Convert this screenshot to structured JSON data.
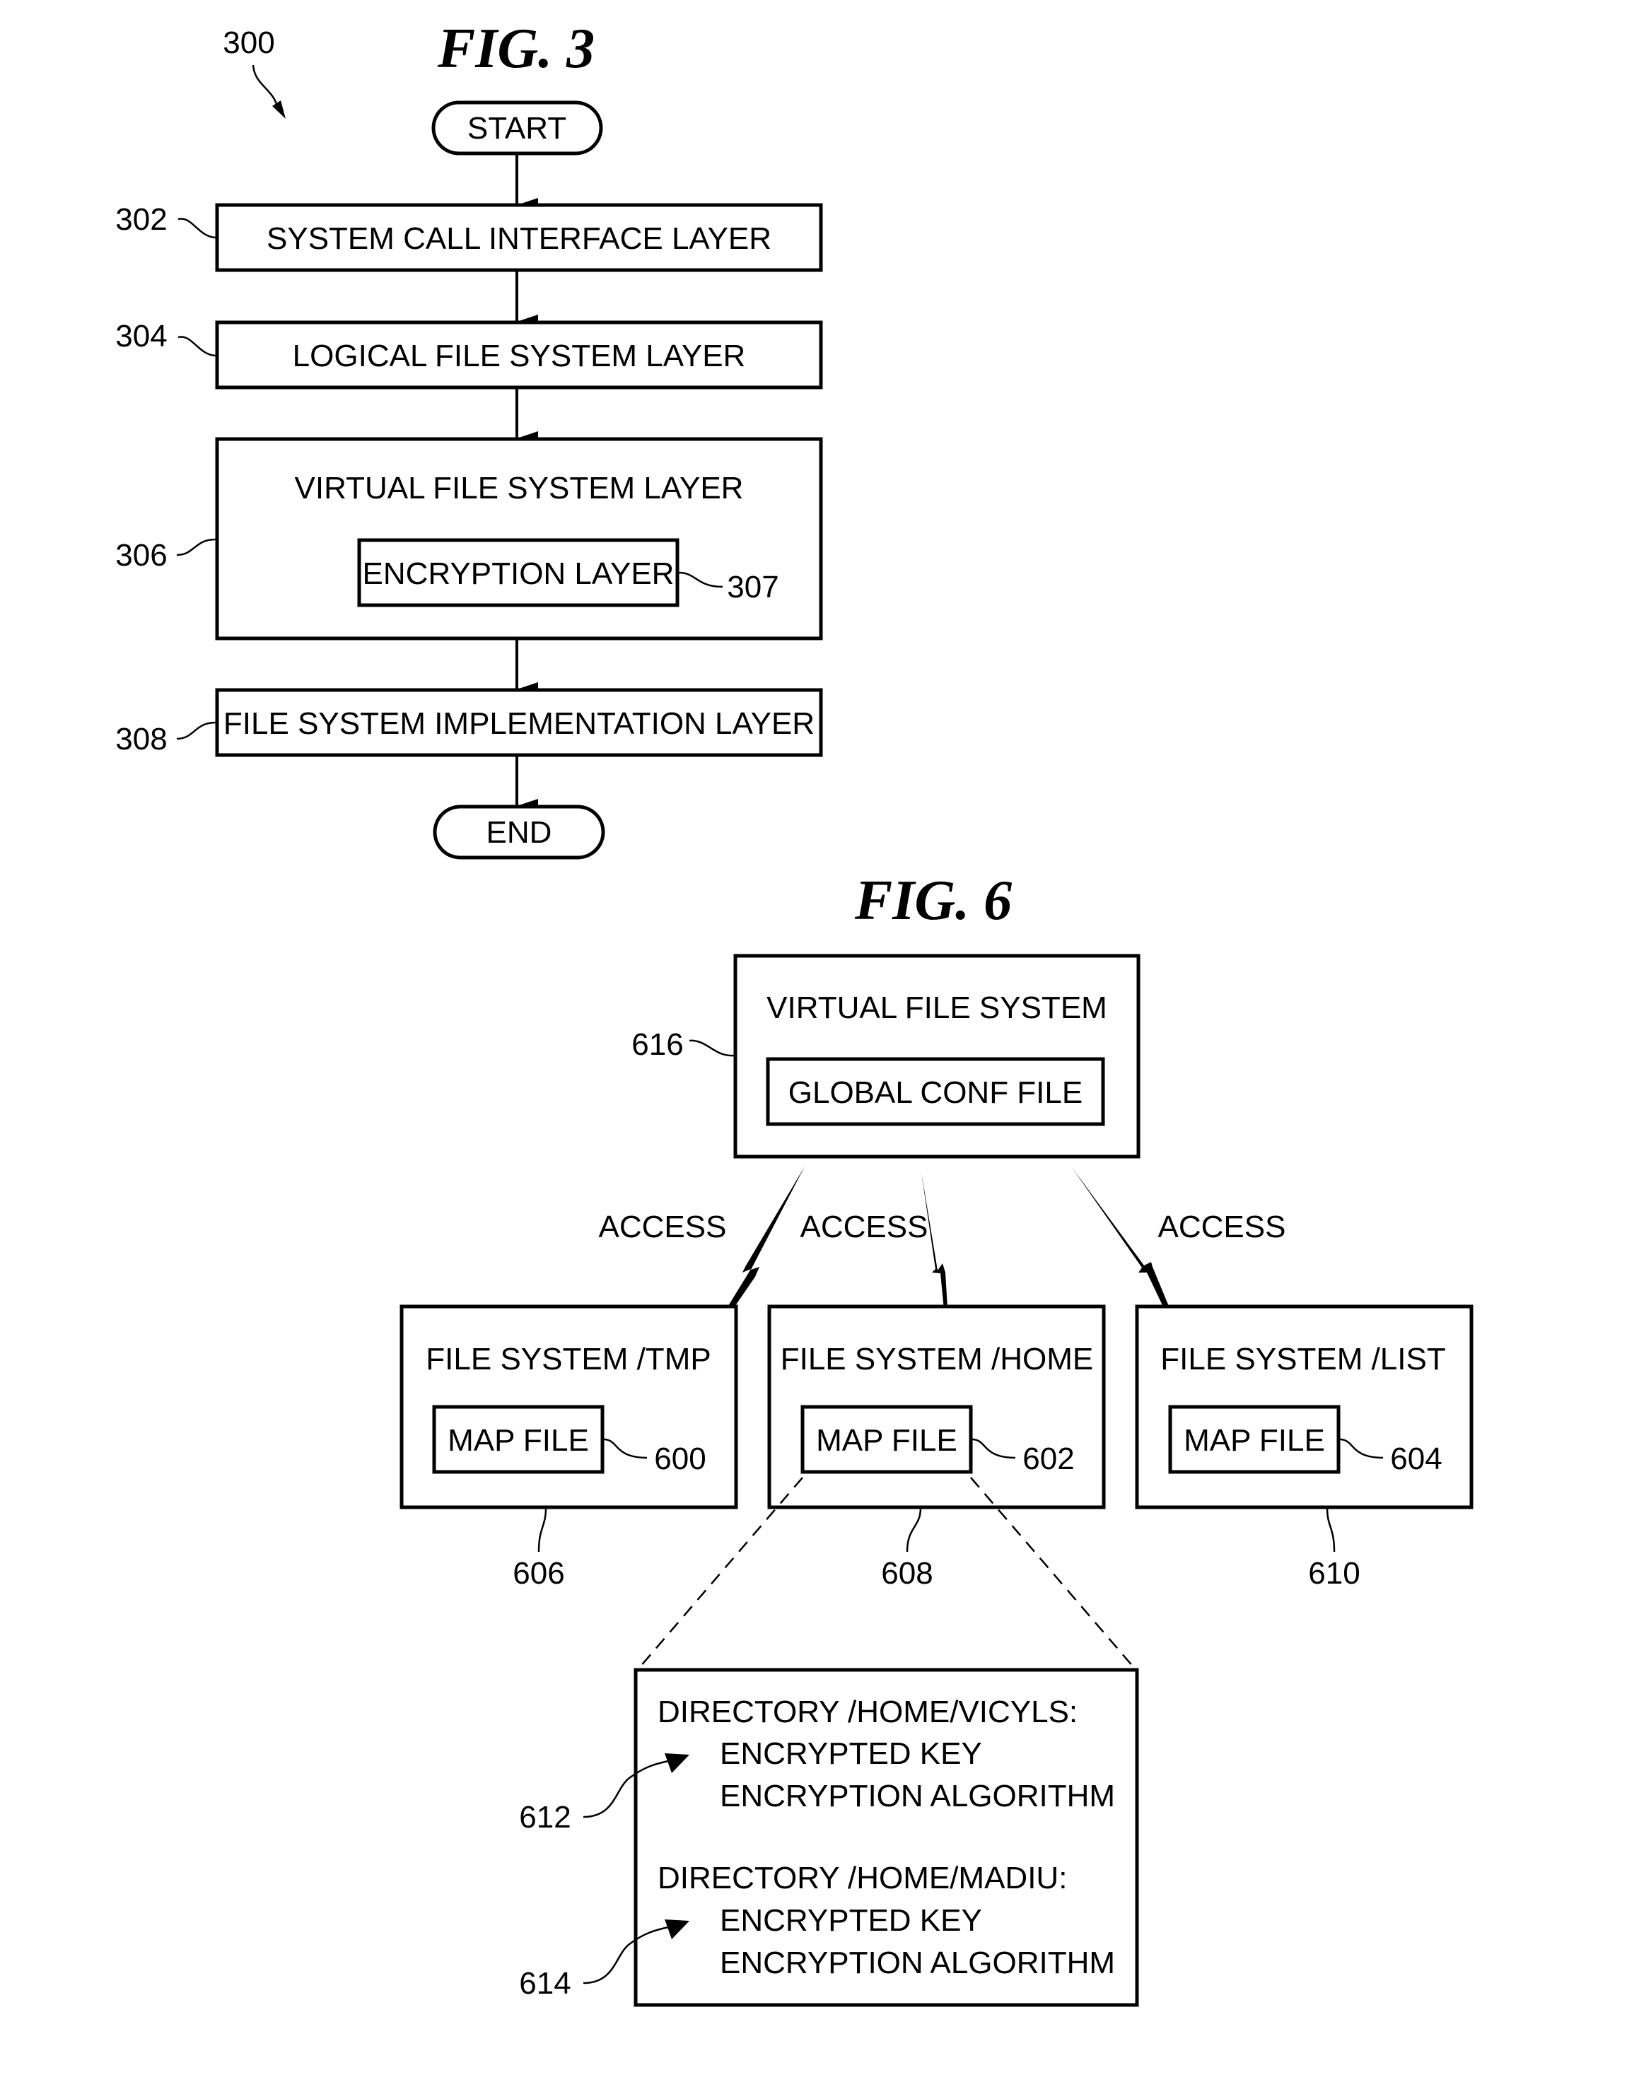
{
  "fig3": {
    "title": "FIG. 3",
    "ref": "300",
    "start": "START",
    "end": "END",
    "layers": [
      {
        "ref": "302",
        "label": "SYSTEM CALL INTERFACE LAYER"
      },
      {
        "ref": "304",
        "label": "LOGICAL FILE SYSTEM LAYER"
      },
      {
        "ref": "306",
        "label": "VIRTUAL FILE SYSTEM LAYER"
      },
      {
        "ref": "308",
        "label": "FILE SYSTEM IMPLEMENTATION LAYER"
      }
    ],
    "inner": {
      "ref": "307",
      "label": "ENCRYPTION LAYER"
    }
  },
  "fig6": {
    "title": "FIG. 6",
    "vfs": {
      "ref": "616",
      "label": "VIRTUAL FILE SYSTEM",
      "inner": "GLOBAL CONF FILE"
    },
    "access_label": "ACCESS",
    "filesystems": [
      {
        "ref": "606",
        "label": "FILE SYSTEM /TMP",
        "map_label": "MAP FILE",
        "map_ref": "600"
      },
      {
        "ref": "608",
        "label": "FILE SYSTEM /HOME",
        "map_label": "MAP FILE",
        "map_ref": "602"
      },
      {
        "ref": "610",
        "label": "FILE SYSTEM /LIST",
        "map_label": "MAP FILE",
        "map_ref": "604"
      }
    ],
    "detail": {
      "entries": [
        {
          "ref": "612",
          "directory": "DIRECTORY /HOME/VICYLS:",
          "items": [
            "ENCRYPTED KEY",
            "ENCRYPTION ALGORITHM"
          ]
        },
        {
          "ref": "614",
          "directory": "DIRECTORY /HOME/MADIU:",
          "items": [
            "ENCRYPTED KEY",
            "ENCRYPTION ALGORITHM"
          ]
        }
      ]
    }
  }
}
